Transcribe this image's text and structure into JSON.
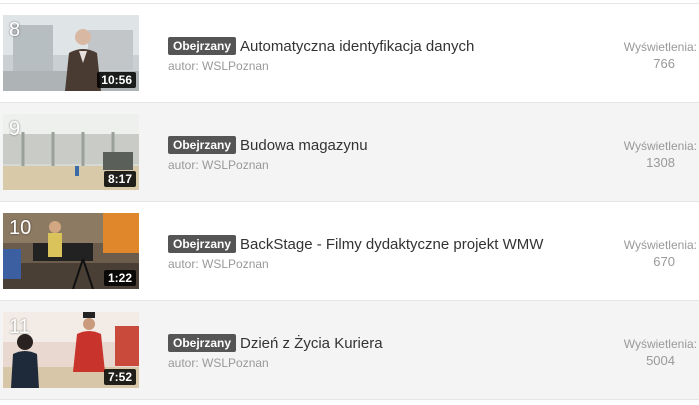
{
  "videos": [
    {
      "index": "8",
      "duration": "10:56",
      "badge": "Obejrzany",
      "title": "Automatyczna identyfikacja danych",
      "author": "autor: WSLPoznan",
      "views_label": "Wyświetlenia:",
      "views": "766"
    },
    {
      "index": "9",
      "duration": "8:17",
      "badge": "Obejrzany",
      "title": "Budowa magazynu",
      "author": "autor: WSLPoznan",
      "views_label": "Wyświetlenia:",
      "views": "1308"
    },
    {
      "index": "10",
      "duration": "1:22",
      "badge": "Obejrzany",
      "title": "BackStage - Filmy dydaktyczne projekt WMW",
      "author": "autor: WSLPoznan",
      "views_label": "Wyświetlenia:",
      "views": "670"
    },
    {
      "index": "11",
      "duration": "7:52",
      "badge": "Obejrzany",
      "title": "Dzień z Życia Kuriera",
      "author": "autor: WSLPoznan",
      "views_label": "Wyświetlenia:",
      "views": "5004"
    }
  ],
  "colors": {
    "badge_bg": "#555555",
    "row_alt_bg": "#f4f4f4",
    "meta_text": "#999999",
    "title_text": "#333333"
  }
}
